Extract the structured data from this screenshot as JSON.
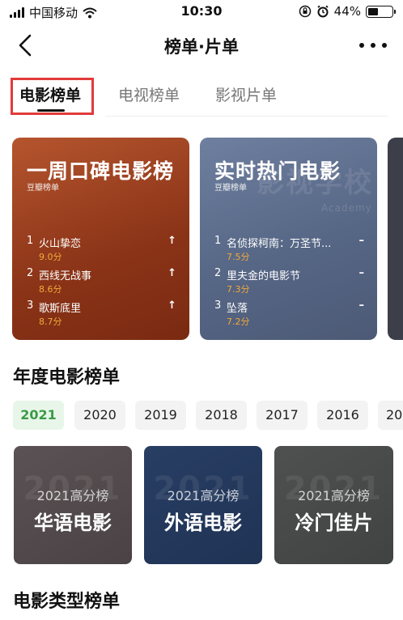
{
  "status": {
    "carrier": "中国移动",
    "time": "10:30",
    "battery": "44%",
    "battery_level": 0.44
  },
  "nav": {
    "title": "榜单·片单"
  },
  "tabs": [
    {
      "label": "电影榜单",
      "active": true
    },
    {
      "label": "电视榜单",
      "active": false
    },
    {
      "label": "影视片单",
      "active": false
    }
  ],
  "hero_cards": [
    {
      "title": "一周口碑电影榜",
      "subtitle": "豆瓣榜单",
      "items": [
        {
          "rank": "1",
          "name": "火山挚恋",
          "score": "9.0分",
          "trend": "↑"
        },
        {
          "rank": "2",
          "name": "西线无战事",
          "score": "8.6分",
          "trend": "↑"
        },
        {
          "rank": "3",
          "name": "歌斯底里",
          "score": "8.7分",
          "trend": "↑"
        }
      ]
    },
    {
      "title": "实时热门电影",
      "subtitle": "豆瓣榜单",
      "watermark": "影视学校",
      "watermark_small": "Academy",
      "items": [
        {
          "rank": "1",
          "name": "名侦探柯南：万圣节...",
          "score": "7.5分",
          "trend": "–"
        },
        {
          "rank": "2",
          "name": "里夫金的电影节",
          "score": "7.3分",
          "trend": "–"
        },
        {
          "rank": "3",
          "name": "坠落",
          "score": "7.2分",
          "trend": "–"
        }
      ]
    }
  ],
  "annual": {
    "title": "年度电影榜单",
    "years": [
      "2021",
      "2020",
      "2019",
      "2018",
      "2017",
      "2016",
      "20"
    ],
    "cards": [
      {
        "line1": "2021高分榜",
        "line2": "华语电影"
      },
      {
        "line1": "2021高分榜",
        "line2": "外语电影"
      },
      {
        "line1": "2021高分榜",
        "line2": "冷门佳片"
      }
    ]
  },
  "genre": {
    "title": "电影类型榜单"
  },
  "colors": {
    "highlight": "#e23a3a",
    "active_chip_text": "#3a9b46",
    "score": "#f2a93b"
  }
}
